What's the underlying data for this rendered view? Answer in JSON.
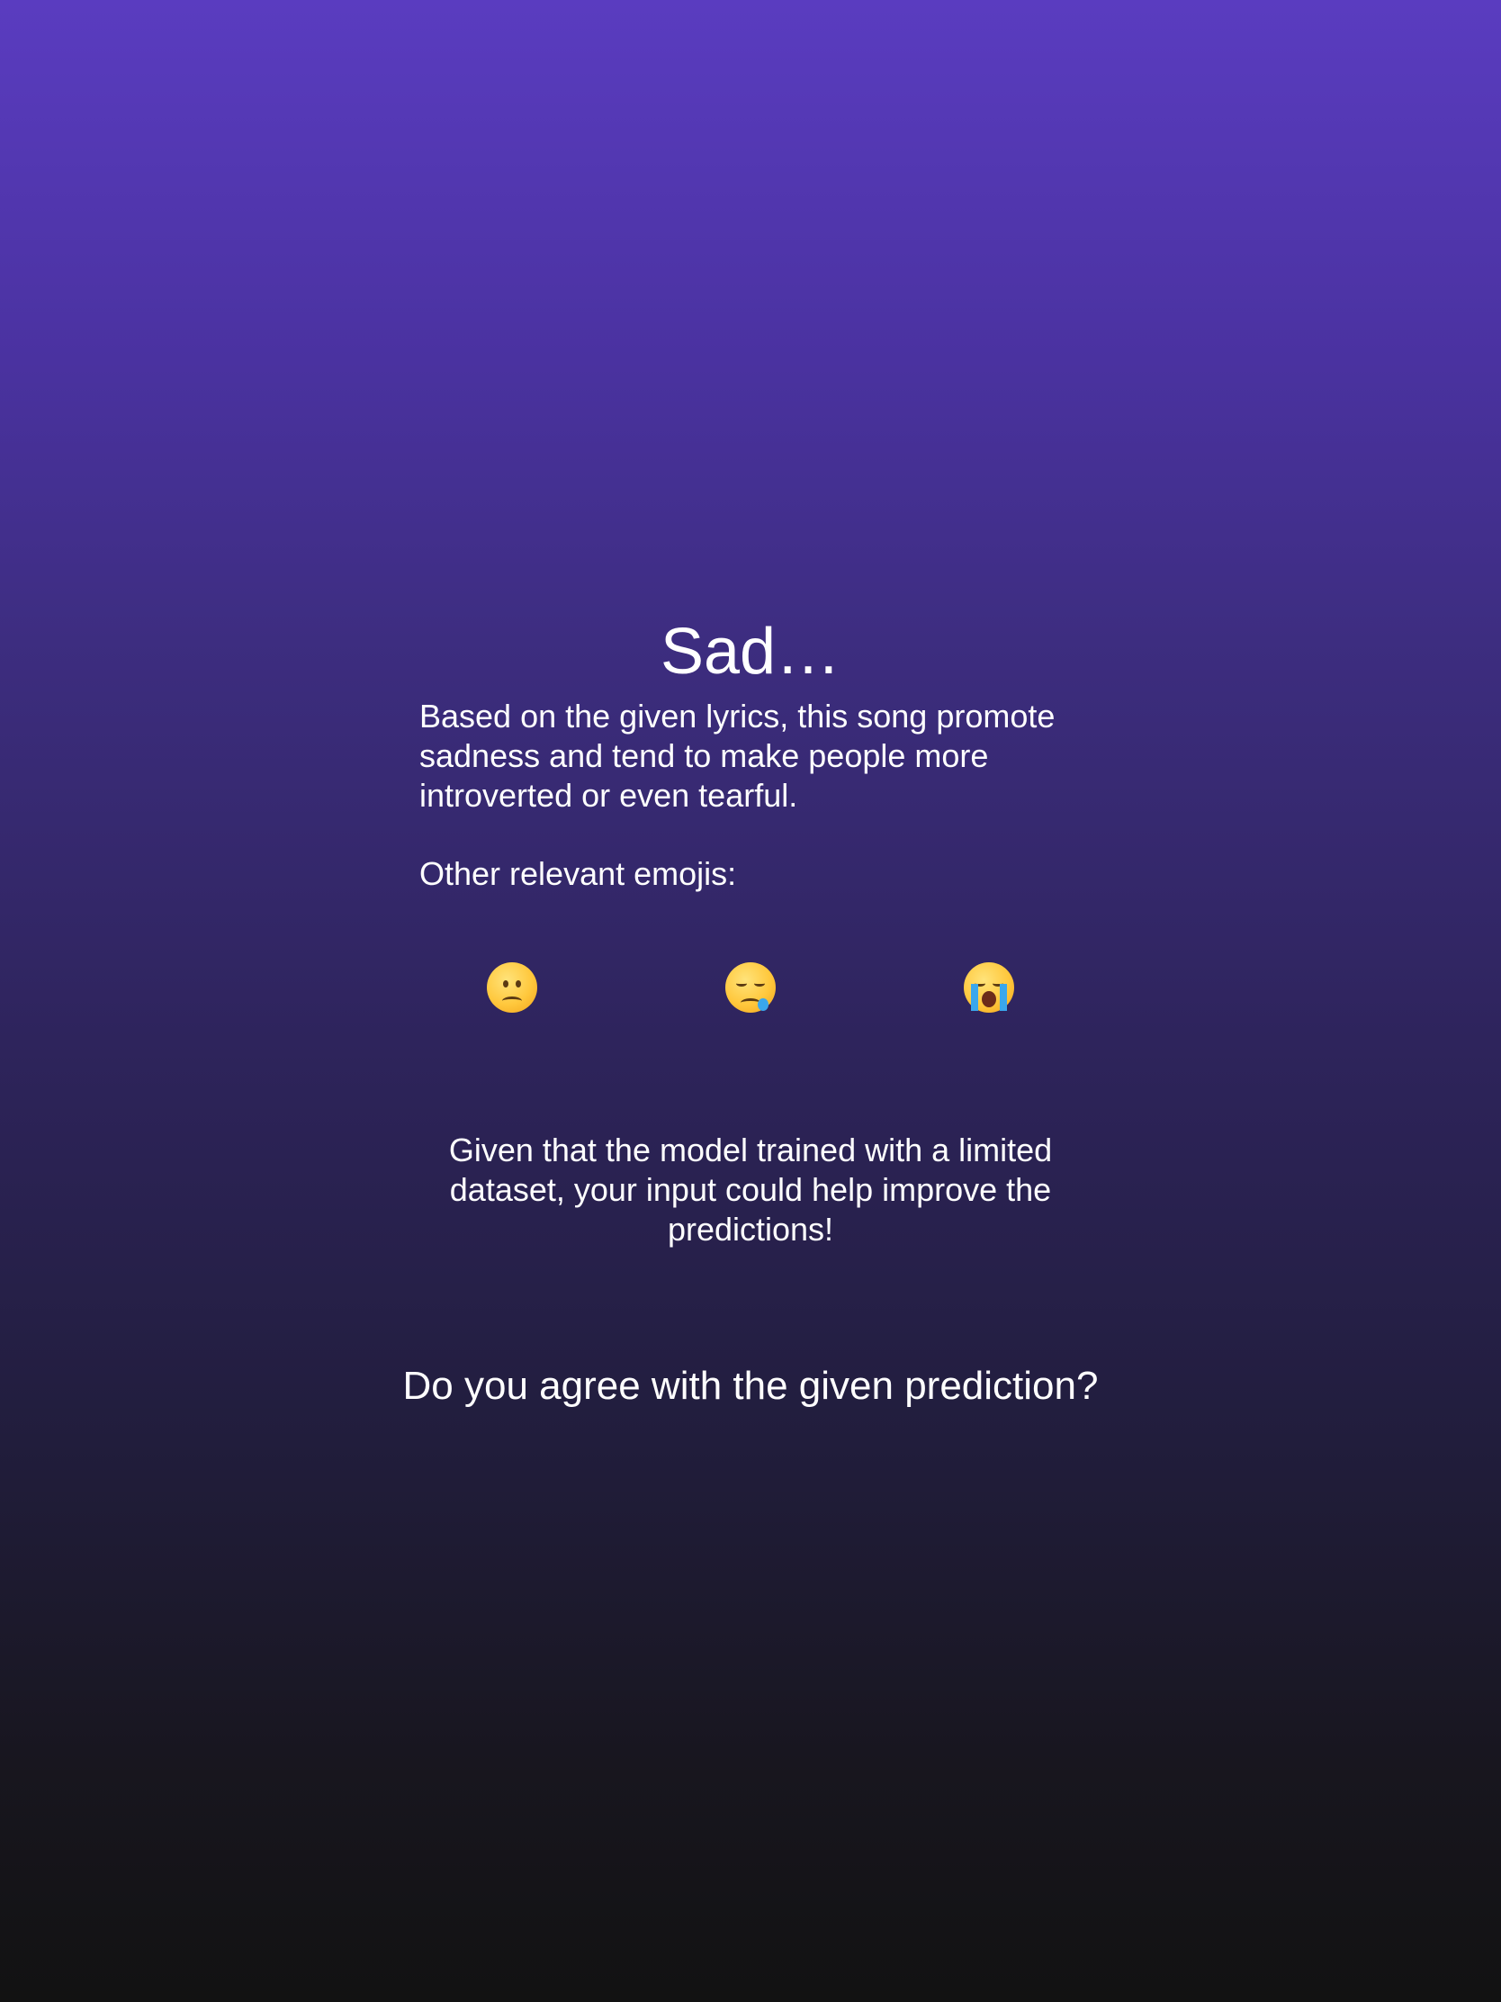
{
  "result": {
    "title": "Sad…",
    "description": "Based on the given lyrics, this song promote sadness and tend to make people more introverted or even tearful.",
    "emoji_label": "Other relevant emojis:"
  },
  "emojis": [
    {
      "icon": "frowning-face-icon"
    },
    {
      "icon": "sleepy-face-icon"
    },
    {
      "icon": "loudly-crying-face-icon"
    }
  ],
  "info": {
    "text": "Given that the model trained with a limited dataset, your input could help improve the predictions!"
  },
  "feedback": {
    "question": "Do you agree with the given prediction?"
  }
}
